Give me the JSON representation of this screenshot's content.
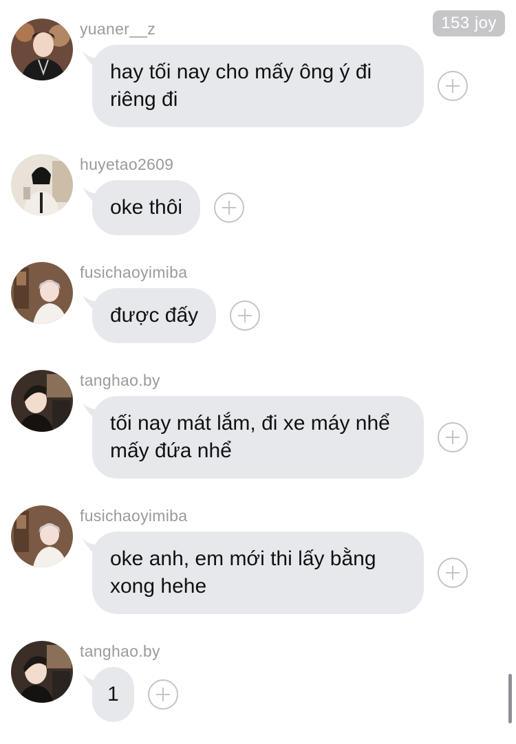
{
  "header": {
    "badge": "153 joy"
  },
  "messages": [
    {
      "username": "yuaner__z",
      "text": "hay tối nay cho mấy ông ý đi riêng đi",
      "avatar": "avatar-yuaner"
    },
    {
      "username": "huyetao2609",
      "text": "oke thôi",
      "avatar": "avatar-huyetao"
    },
    {
      "username": "fusichaoyimiba",
      "text": "được đấy",
      "avatar": "avatar-fusichao"
    },
    {
      "username": "tanghao.by",
      "text": "tối nay mát lắm, đi xe máy nhể mấy đứa nhể",
      "avatar": "avatar-tanghao"
    },
    {
      "username": "fusichaoyimiba",
      "text": "oke anh, em mới thi lấy bằng xong hehe",
      "avatar": "avatar-fusichao"
    },
    {
      "username": "tanghao.by",
      "text": "1",
      "avatar": "avatar-tanghao"
    }
  ],
  "colors": {
    "bubble": "#e6e8ec",
    "username": "#9a9aa0",
    "badge_bg": "#c6c6c9"
  }
}
